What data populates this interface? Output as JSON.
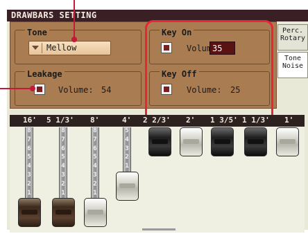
{
  "title": "DRAWBARS SETTING",
  "tone": {
    "label": "Tone",
    "selected": "Mellow"
  },
  "leakage": {
    "label": "Leakage",
    "volume_label": "Volume:",
    "volume_value": "54"
  },
  "key_on": {
    "label": "Key On",
    "volume_label": "Volume:",
    "volume_value": "35"
  },
  "key_off": {
    "label": "Key Off",
    "volume_label": "Volume:",
    "volume_value": "25"
  },
  "tabs": [
    {
      "line1": "Perc.",
      "line2": "Rotary"
    },
    {
      "line1": "Tone",
      "line2": "Noise"
    }
  ],
  "drawbars": [
    {
      "footage": "16'",
      "setting": 8,
      "color": "brown"
    },
    {
      "footage": "5 1/3'",
      "setting": 8,
      "color": "brown"
    },
    {
      "footage": "8'",
      "setting": 8,
      "color": "white"
    },
    {
      "footage": "4'",
      "setting": 5,
      "color": "white"
    },
    {
      "footage": "2 2/3'",
      "setting": 0,
      "color": "black"
    },
    {
      "footage": "2'",
      "setting": 0,
      "color": "white"
    },
    {
      "footage": "1 3/5'",
      "setting": 0,
      "color": "black"
    },
    {
      "footage": "1 1/3'",
      "setting": 0,
      "color": "black"
    },
    {
      "footage": "1'",
      "setting": 0,
      "color": "white"
    }
  ],
  "colors": {
    "highlight": "#e8263a",
    "title_bg": "#3a1f24",
    "panel": "#a97c52",
    "value_bg": "#5a1212"
  }
}
